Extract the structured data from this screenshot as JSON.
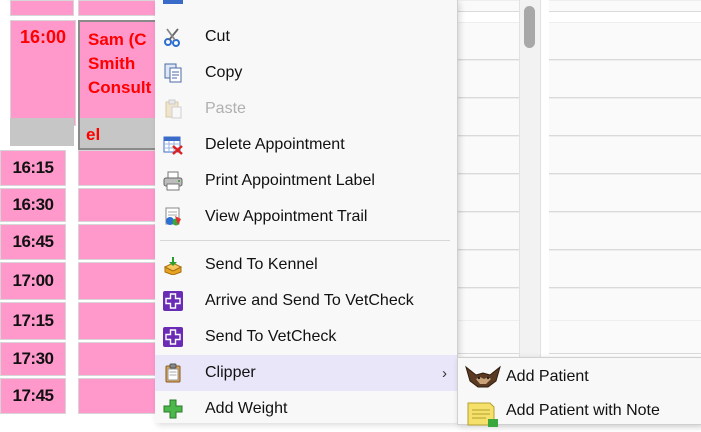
{
  "schedule": {
    "current_time": "16:00",
    "appointment": {
      "line1": "Sam (C",
      "line2": "Smith",
      "line3": "Consult",
      "line4": "el"
    },
    "times": [
      "16:15",
      "16:30",
      "16:45",
      "17:00",
      "17:15",
      "17:30",
      "17:45"
    ]
  },
  "context_menu": {
    "items": [
      {
        "label": "Cut",
        "icon": "scissors-icon",
        "enabled": true
      },
      {
        "label": "Copy",
        "icon": "copy-icon",
        "enabled": true
      },
      {
        "label": "Paste",
        "icon": "paste-icon",
        "enabled": false
      },
      {
        "label": "Delete Appointment",
        "icon": "delete-appointment-icon",
        "enabled": true
      },
      {
        "label": "Print Appointment Label",
        "icon": "printer-icon",
        "enabled": true
      },
      {
        "label": "View Appointment Trail",
        "icon": "appointment-trail-icon",
        "enabled": true
      },
      {
        "label": "Send To Kennel",
        "icon": "kennel-icon",
        "enabled": true
      },
      {
        "label": "Arrive and Send To VetCheck",
        "icon": "vetcheck-cross-icon",
        "enabled": true
      },
      {
        "label": "Send To VetCheck",
        "icon": "vetcheck-cross-icon",
        "enabled": true
      },
      {
        "label": "Clipper",
        "icon": "clipboard-icon",
        "enabled": true,
        "has_submenu": true,
        "highlighted": true
      },
      {
        "label": "Add Weight",
        "icon": "plus-icon",
        "enabled": true
      }
    ]
  },
  "submenu": {
    "items": [
      {
        "label": "Add Patient",
        "icon": "animal-patient-icon"
      },
      {
        "label": "Add Patient with Note",
        "icon": "note-icon"
      }
    ]
  },
  "colors": {
    "slot_pink": "#ff99cc",
    "appointment_text": "#ff0000",
    "menu_highlight": "#e8e6f8",
    "vetcheck_purple": "#6a2bb5"
  }
}
